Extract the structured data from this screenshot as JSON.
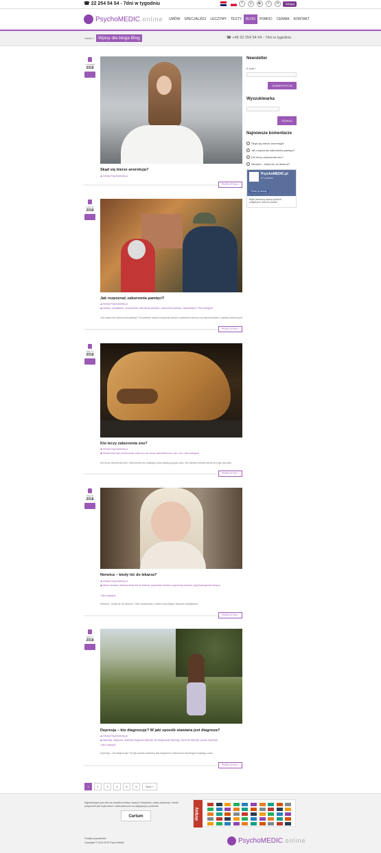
{
  "topbar": {
    "phone": "22 254 54 54 - 7dni w tygodniu",
    "login_label": "Zaloguj",
    "social_icons": [
      "facebook-icon",
      "pinterest-icon",
      "youtube-icon",
      "twitter-icon",
      "linkedin-icon"
    ]
  },
  "header": {
    "logo_text_main": "PsychoMEDIC",
    "logo_text_suffix": ".online",
    "nav": [
      "UMÓW",
      "SPECJALIŚCI",
      "LECZYMY",
      "TESTY",
      "BLOG",
      "POMOC",
      "CENNIK",
      "KONTAKT"
    ],
    "active_nav": "BLOG"
  },
  "breadcrumb": {
    "home": "Home",
    "separator": "»",
    "title": "Wpisy dla bloga Blog",
    "phone": "+48 22 254 54 54 - 7dni w tygodniu"
  },
  "posts": [
    {
      "month": "Listopad",
      "year": "2018",
      "title": "Skąd się bierze anoreksja?",
      "author": "Klinika PsychoMedic.pl",
      "tags": "",
      "category": "",
      "excerpt": "",
      "more": "PRZECZYTAJ »",
      "image": "portrait-woman-wind"
    },
    {
      "month": "Luty 01",
      "year": "2018",
      "title": "Jak rozpoznać zaburzenia pamięci?",
      "author": "Klinika PsychoMedic.pl",
      "tags": "pamięć, pamiętanie, rozpoznanie zaburzenia pamięci, zaburzenia pamięci, zapominanie",
      "category": "Bez kategorii",
      "excerpt": "Jak rozpoznać zaburzenia pamięci? Oczywiście każdy borykał się kiedyś z gubieniem kluczy czy zapominaniem o jakiejś ważnej sprawie.",
      "more": "PRZECZYTAJ »",
      "image": "elderly-couple-autumn"
    },
    {
      "month": "Maj 21",
      "year": "2018",
      "title": "Kto leczy zaburzenia snu?",
      "author": "Klinika PsychoMedic.pl",
      "tags": "bezsenność lęki, bezsenność, brak snu, kto leczy zaburzenia snu, sen, snu",
      "category": "Bez kategorii",
      "excerpt": "Kto leczy zaburzenia snu? Zaburzenia snu dotykają coraz większą grupę osób. Nie zawsze jednak wiemy do kogo się udać.",
      "more": "PRZECZYTAJ »",
      "image": "sleeping-lion"
    },
    {
      "month": "Maj 06",
      "year": "2018",
      "title": "Nerwica – kiedy iść do lekarza?",
      "author": "Klinika PsychoMedic.pl",
      "tags": "lekarz nerwica, Nerwica kiedy iść do lekarza, psychiatra nerwica, psycholog nerwica, psychoterapeuta nerwica",
      "category": "Bez kategorii",
      "excerpt": "Nerwica – kiedy iść do lekarza? Jeśli zauważymy u siebie niepokojące fizyczne dolegliwości.",
      "more": "PRZECZYTAJ »",
      "image": "woman-sweater-face"
    },
    {
      "month": "Maj 11",
      "year": "2018",
      "title": "Depresja – kto diagnozuje? W jaki sposób stawiana jest diagnoza?",
      "author": "Klinika PsychoMedic.pl",
      "tags": "depresja, diagnoza, depresji, diagnoza depresji, kto diagnozuje depresję, leczenie depresji, pomoc depresja",
      "category": "Bez kategorii",
      "excerpt": "Depresja – kto diagnozuje? W jaki sposób stawiana jest diagnoza? Zaburzenia depresyjne dotykają coraz...",
      "more": "PRZECZYTAJ »",
      "image": "woman-in-meadow"
    }
  ],
  "sidebar": {
    "newsletter_heading": "Newsletter",
    "email_label": "E-mail *",
    "subscribe_label": "SUBSKRYPCJA",
    "search_heading": "Wyszukiwarka",
    "search_label": "SZUKAJ",
    "comments_heading": "Najnowsze komentarze",
    "comments": [
      "Skąd się bierze anoreksja?",
      "Jak rozpoznać zaburzenia pamięci?",
      "Kto leczy zaburzenia snu?",
      "Nerwica – kiedy iść do lekarza?"
    ],
    "fb_name": "PsychoMEDIC.pl",
    "fb_likes": "87 polubień",
    "fb_like_label": "Polub tę stronę",
    "fb_bottom": "Bądź pierwszą osobą spośród znajomych, która to polubi"
  },
  "pagination": {
    "pages": [
      "1",
      "2",
      "3",
      "4",
      "5",
      "6"
    ],
    "current": "1",
    "next": "Next »"
  },
  "footer": {
    "note": "Najważniejsze jest dla nas bezpieczeństwo naszych Pacjentów i pełna dyskrecja. Każde połączenie jest szyfrowane i zabezpieczone na najwyższym poziomie.",
    "certum_label": "Certum",
    "dotpay_label": "dotpay",
    "privacy": "Polityka prywatności",
    "copyright": "Copyright © 2014-2019 PsychoMedic"
  },
  "colors": {
    "accent": "#9b59b6",
    "brand": "#8e44ad"
  }
}
